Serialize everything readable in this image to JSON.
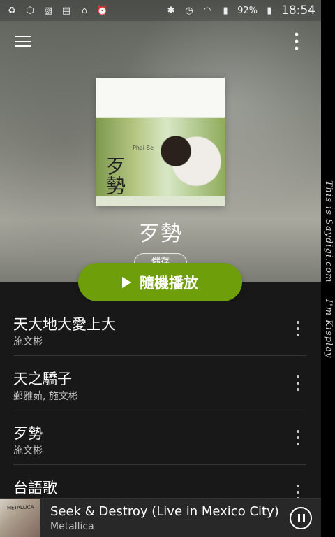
{
  "status_bar": {
    "battery": "92%",
    "time": "18:54"
  },
  "album": {
    "title": "歹勢",
    "save_label": "儲存",
    "shuffle_label": "隨機播放"
  },
  "tracks": [
    {
      "title": "天大地大愛上大",
      "artist": "施文彬"
    },
    {
      "title": "天之驕子",
      "artist": "鄞雅茹, 施文彬"
    },
    {
      "title": "歹勢",
      "artist": "施文彬"
    },
    {
      "title": "台語歌",
      "artist": ""
    }
  ],
  "mini_player": {
    "title": "Seek & Destroy (Live in Mexico City)",
    "artist": "Metallica"
  },
  "side_texts": [
    "This is Saydigi.com",
    "I'm Kisplay"
  ]
}
